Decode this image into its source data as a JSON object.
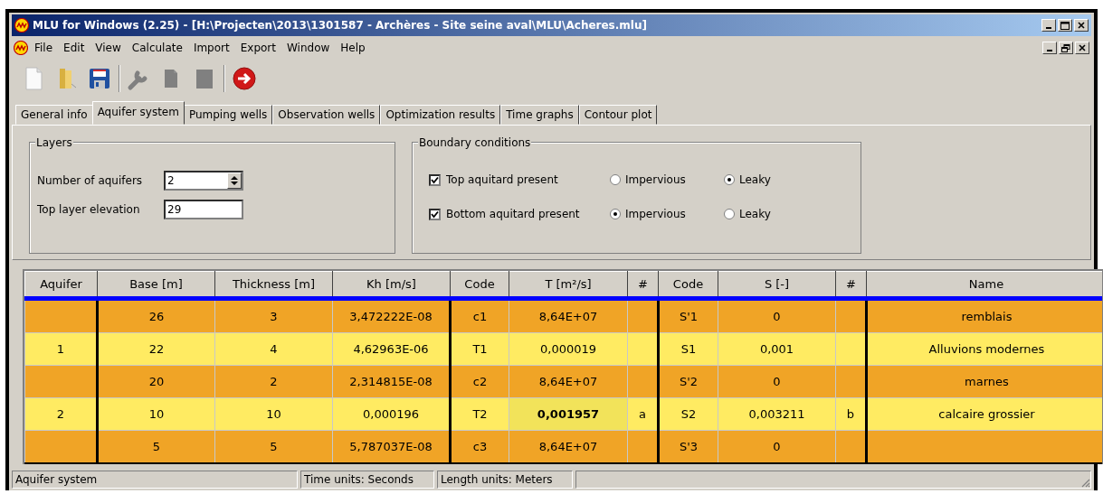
{
  "window": {
    "title": "MLU for Windows (2.25) - [H:\\Projecten\\2013\\1301587 - Archères - Site seine aval\\MLU\\Acheres.mlu]"
  },
  "menu": [
    "File",
    "Edit",
    "View",
    "Calculate",
    "Import",
    "Export",
    "Window",
    "Help"
  ],
  "toolbar": [
    {
      "kind": "new",
      "disabled": false
    },
    {
      "kind": "open",
      "disabled": false
    },
    {
      "kind": "save",
      "disabled": false
    },
    {
      "kind": "separator"
    },
    {
      "kind": "wrench",
      "disabled": true
    },
    {
      "kind": "copy",
      "disabled": true
    },
    {
      "kind": "page",
      "disabled": true
    },
    {
      "kind": "separator"
    },
    {
      "kind": "run",
      "disabled": false
    }
  ],
  "tabs": [
    {
      "label": "General info",
      "selected": false
    },
    {
      "label": "Aquifer system",
      "selected": true
    },
    {
      "label": "Pumping wells",
      "selected": false
    },
    {
      "label": "Observation wells",
      "selected": false
    },
    {
      "label": "Optimization results",
      "selected": false
    },
    {
      "label": "Time graphs",
      "selected": false
    },
    {
      "label": "Contour plot",
      "selected": false
    }
  ],
  "layers": {
    "title": "Layers",
    "fields": [
      {
        "label": "Number of aquifers",
        "value": "2",
        "kind": "spin"
      },
      {
        "label": "Top layer elevation",
        "value": "29",
        "kind": "text"
      }
    ]
  },
  "boundary": {
    "title": "Boundary conditions",
    "rows": [
      {
        "label": "Top aquitard present",
        "checked": true,
        "options": [
          {
            "label": "Impervious",
            "selected": false
          },
          {
            "label": "Leaky",
            "selected": true
          }
        ]
      },
      {
        "label": "Bottom aquitard present",
        "checked": true,
        "options": [
          {
            "label": "Impervious",
            "selected": true
          },
          {
            "label": "Leaky",
            "selected": false
          }
        ]
      }
    ]
  },
  "table": {
    "columns": [
      "Aquifer",
      "Base [m]",
      "Thickness [m]",
      "Kh [m/s]",
      "Code",
      "T [m²/s]",
      "#",
      "Code",
      "S [-]",
      "#",
      "Name"
    ],
    "rows": [
      {
        "kind": "aquitard",
        "cells": [
          "",
          "26",
          "3",
          "3,472222E-08",
          "c1",
          "8,64E+07",
          "",
          "S'1",
          "0",
          "",
          "remblais"
        ],
        "t_selected": false
      },
      {
        "kind": "aquifer",
        "cells": [
          "1",
          "22",
          "4",
          "4,62963E-06",
          "T1",
          "0,000019",
          "",
          "S1",
          "0,001",
          "",
          "Alluvions modernes"
        ],
        "t_selected": false
      },
      {
        "kind": "aquitard",
        "cells": [
          "",
          "20",
          "2",
          "2,314815E-08",
          "c2",
          "8,64E+07",
          "",
          "S'2",
          "0",
          "",
          "marnes"
        ],
        "t_selected": false
      },
      {
        "kind": "aquifer",
        "cells": [
          "2",
          "10",
          "10",
          "0,000196",
          "T2",
          "0,001957",
          "a",
          "S2",
          "0,003211",
          "b",
          "calcaire grossier"
        ],
        "t_selected": true
      },
      {
        "kind": "aquitard",
        "cells": [
          "",
          "5",
          "5",
          "5,787037E-08",
          "c3",
          "8,64E+07",
          "",
          "S'3",
          "0",
          "",
          ""
        ],
        "t_selected": false
      }
    ]
  },
  "status_bar": [
    "Aquifer system",
    "Time units: Seconds",
    "Length units: Meters"
  ]
}
